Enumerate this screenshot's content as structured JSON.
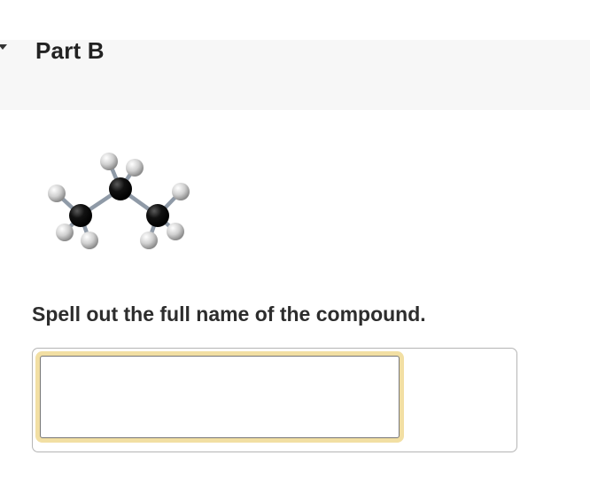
{
  "part": {
    "title": "Part B",
    "collapse_icon": "chevron-down-icon"
  },
  "molecule": {
    "icon": "propane-ball-and-stick-model",
    "atom_colors": {
      "carbon": "#111111",
      "hydrogen": "#d0d0d0",
      "bond": "#8f9aa7"
    }
  },
  "question": {
    "prompt": "Spell out the full name of the compound."
  },
  "answer": {
    "value": "",
    "placeholder": "",
    "focus_color": "#f2dfa3"
  }
}
